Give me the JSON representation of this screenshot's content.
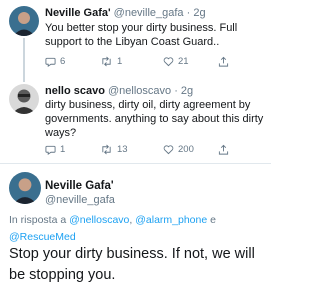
{
  "tweets": [
    {
      "name": "Neville Gafa'",
      "handle": "@neville_gafa",
      "time": "2g",
      "text": "You better stop your dirty business. Full support to the Libyan Coast Guard..",
      "replies": "6",
      "retweets": "1",
      "likes": "21"
    },
    {
      "name": "nello scavo",
      "handle": "@nelloscavo",
      "time": "2g",
      "text": "dirty business, dirty oil, dirty agreement by governments. anything to say about this dirty ways?",
      "replies": "1",
      "retweets": "13",
      "likes": "200"
    }
  ],
  "main_tweet": {
    "name": "Neville Gafa'",
    "handle": "@neville_gafa",
    "reply_prefix": "In risposta a",
    "mentions": [
      "@nelloscavo",
      "@alarm_phone",
      "@RescueMed"
    ],
    "conjunction": "e",
    "text": "Stop your dirty business. If not, we will be stopping you."
  },
  "icons": [
    "reply-icon",
    "retweet-icon",
    "like-icon",
    "share-icon"
  ]
}
